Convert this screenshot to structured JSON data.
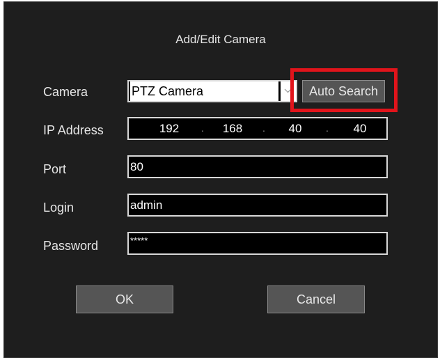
{
  "dialog": {
    "title": "Add/Edit Camera"
  },
  "fields": {
    "camera": {
      "label": "Camera",
      "selected": "PTZ Camera"
    },
    "ip_address": {
      "label": "IP  Address",
      "octets": [
        "192",
        "168",
        "40",
        "40"
      ],
      "separator": "."
    },
    "port": {
      "label": "Port",
      "value": "80"
    },
    "login": {
      "label": "Login",
      "value": "admin"
    },
    "password": {
      "label": "Password",
      "value": "*****"
    }
  },
  "buttons": {
    "auto_search": "Auto Search",
    "ok": "OK",
    "cancel": "Cancel"
  },
  "colors": {
    "background": "#1e1e1e",
    "text": "#e6e6e6",
    "highlight": "#e1141b",
    "button": "#555555"
  },
  "icons": {
    "dropdown": "chevron-down-icon"
  }
}
